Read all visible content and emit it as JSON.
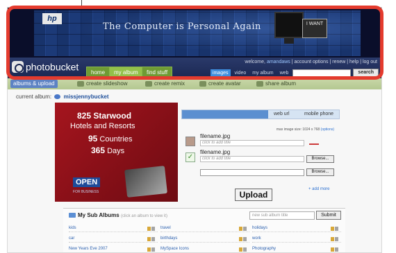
{
  "banner": {
    "logo_text": "hp",
    "tagline": "The Computer is Personal Again",
    "badge_text": "I WANT"
  },
  "header": {
    "brand": "photobucket",
    "nav": [
      "home",
      "my album",
      "find stuff"
    ],
    "welcome_prefix": "welcome,",
    "username": "amandaws",
    "links": "account options | renew | help | log out",
    "search_tabs": [
      "images",
      "video",
      "my album",
      "web"
    ],
    "search_placeholder": "",
    "search_button": "search"
  },
  "toolbar": {
    "items": [
      "albums & upload",
      "create slideshow",
      "create remix",
      "create avatar",
      "share album"
    ]
  },
  "album": {
    "label": "current album:",
    "name": "missjennybucket"
  },
  "ad": {
    "line1": "825 Starwood",
    "line2": "Hotels and Resorts",
    "line3_num": "95",
    "line3_txt": " Countries",
    "line4_num": "365",
    "line4_txt": " Days",
    "open": "OPEN",
    "open_sub": "FOR BUSINESS"
  },
  "upload": {
    "tabs": [
      "web url",
      "mobile phone"
    ],
    "max_size": "max image size: 1024 x 768",
    "options_link": "(options)",
    "file1": "filename.jpg",
    "file2": "filename.jpg",
    "title_placeholder": "click to add title",
    "browse_label": "Browse...",
    "upload_button": "Upload",
    "add_more": "add more"
  },
  "sub_albums": {
    "title": "My Sub Albums",
    "hint": "(click an album to view it)",
    "new_placeholder": "new sub album title",
    "submit": "Submit",
    "items": [
      [
        "kids",
        "travel",
        "holidays"
      ],
      [
        "car",
        "birthdays",
        "work"
      ],
      [
        "New Years Eve 2007",
        "MySpace Icons",
        "Photography"
      ]
    ]
  }
}
